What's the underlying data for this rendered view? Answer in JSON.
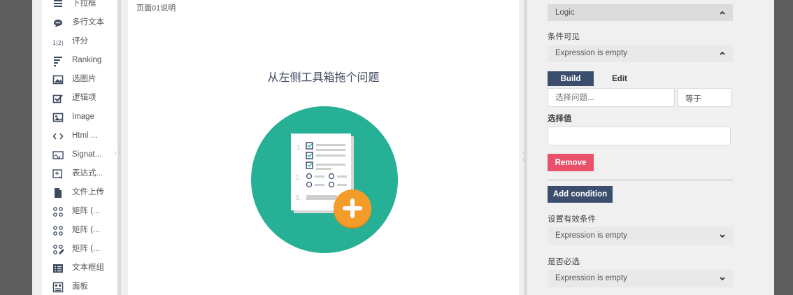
{
  "toolbox": {
    "items": [
      {
        "label": "下拉框",
        "icon": "dropdown-icon"
      },
      {
        "label": "多行文本",
        "icon": "comment-icon"
      },
      {
        "label": "评分",
        "icon": "rating-icon"
      },
      {
        "label": "Ranking",
        "icon": "ranking-icon"
      },
      {
        "label": "选图片",
        "icon": "image-picker-icon"
      },
      {
        "label": "逻辑项",
        "icon": "checkbox-icon"
      },
      {
        "label": "Image",
        "icon": "image-icon"
      },
      {
        "label": "Html ...",
        "icon": "code-icon"
      },
      {
        "label": "Signat...",
        "icon": "signature-icon"
      },
      {
        "label": "表达式...",
        "icon": "expression-icon"
      },
      {
        "label": "文件上传",
        "icon": "file-icon"
      },
      {
        "label": "矩阵 (...",
        "icon": "matrix-icon"
      },
      {
        "label": "矩阵 (...",
        "icon": "matrix-icon"
      },
      {
        "label": "矩阵 (...",
        "icon": "matrix-edit-icon"
      },
      {
        "label": "文本框组",
        "icon": "text-group-icon"
      },
      {
        "label": "面板",
        "icon": "panel-icon"
      }
    ]
  },
  "canvas": {
    "page_label": "页面01说明",
    "drop_hint": "从左侧工具箱拖个问题"
  },
  "properties": {
    "section_title": "Logic",
    "visible_if_label": "条件可见",
    "visible_if_value": "Expression is empty",
    "build_tab": "Build",
    "edit_tab": "Edit",
    "question_placeholder": "选择问题...",
    "operator_value": "等于",
    "select_value_label": "选择值",
    "remove_label": "Remove",
    "add_condition_label": "Add condition",
    "enable_if_label": "设置有效条件",
    "enable_if_value": "Expression is empty",
    "required_if_label": "是否必选",
    "required_if_value": "Expression is empty"
  },
  "colors": {
    "accent_dark": "#3b4e6e",
    "danger": "#e9506a",
    "illustration_teal": "#26b095",
    "illustration_orange": "#f39c29"
  }
}
